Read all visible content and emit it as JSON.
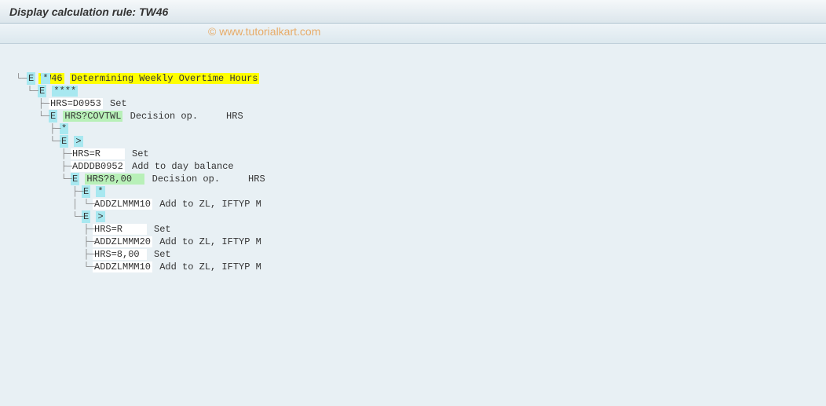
{
  "header": {
    "title": "Display calculation rule: TW46",
    "watermark": "© www.tutorialkart.com"
  },
  "tree": {
    "root_code": "TW46",
    "root_desc": "Determining Weekly Overtime Hours",
    "rows": [
      {
        "indent": "└─",
        "toggle": "E",
        "code": "*",
        "code_hl": "cyan"
      },
      {
        "indent": "  └─",
        "toggle": "E",
        "code": "****",
        "code_hl": "cyan"
      },
      {
        "indent": "    ├─",
        "code": "HRS=D0953",
        "code_hl": "white",
        "desc": "Set"
      },
      {
        "indent": "    └─",
        "toggle": "E",
        "code": "HRS?COVTWL",
        "code_hl": "green",
        "desc": "Decision op.     HRS"
      },
      {
        "indent": "      ├─",
        "code": "*",
        "code_hl": "cyan"
      },
      {
        "indent": "      └─",
        "toggle": "E",
        "code": ">",
        "code_hl": "cyan"
      },
      {
        "indent": "        ├─",
        "code": "HRS=R    ",
        "code_hl": "white",
        "desc": "Set"
      },
      {
        "indent": "        ├─",
        "code": "ADDDB0952",
        "code_hl": "white",
        "desc": "Add to day balance"
      },
      {
        "indent": "        └─",
        "toggle": "E",
        "code": "HRS?8,00  ",
        "code_hl": "green",
        "desc": "Decision op.     HRS"
      },
      {
        "indent": "          ├─",
        "toggle": "E",
        "code": "*",
        "code_hl": "cyan"
      },
      {
        "indent": "          │ └─",
        "code": "ADDZLMMM10",
        "code_hl": "white",
        "desc": "Add to ZL, IFTYP M"
      },
      {
        "indent": "          └─",
        "toggle": "E",
        "code": ">",
        "code_hl": "cyan"
      },
      {
        "indent": "            ├─",
        "code": "HRS=R    ",
        "code_hl": "white",
        "desc": "Set"
      },
      {
        "indent": "            ├─",
        "code": "ADDZLMMM20",
        "code_hl": "white",
        "desc": "Add to ZL, IFTYP M"
      },
      {
        "indent": "            ├─",
        "code": "HRS=8,00 ",
        "code_hl": "white",
        "desc": "Set"
      },
      {
        "indent": "            └─",
        "code": "ADDZLMMM10",
        "code_hl": "white",
        "desc": "Add to ZL, IFTYP M"
      }
    ]
  }
}
